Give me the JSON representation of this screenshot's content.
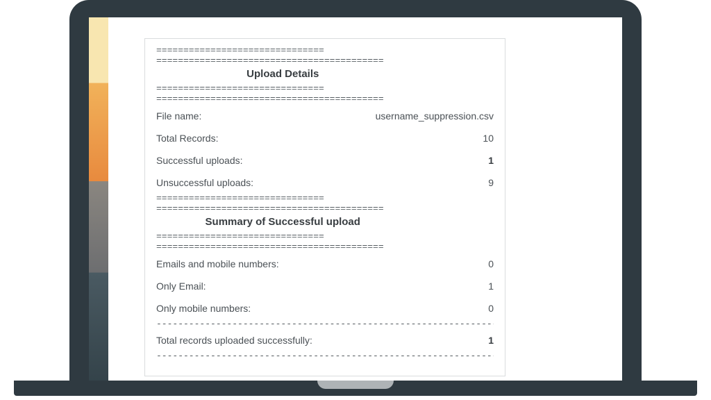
{
  "dividers": {
    "short": "===============================",
    "long": "==========================================",
    "dots": "------------------------------------------------------------------------------------------------------------"
  },
  "sections": {
    "uploadDetails": {
      "title": "Upload Details",
      "rows": {
        "fileName": {
          "label": "File name:",
          "value": "username_suppression.csv",
          "bold": false
        },
        "total": {
          "label": "Total Records:",
          "value": "10",
          "bold": false
        },
        "successful": {
          "label": "Successful uploads:",
          "value": "1",
          "bold": true
        },
        "failed": {
          "label": "Unsuccessful uploads:",
          "value": "9",
          "bold": false
        }
      }
    },
    "summary": {
      "title": "Summary of Successful upload",
      "rows": {
        "both": {
          "label": "Emails and mobile numbers:",
          "value": "0",
          "bold": false
        },
        "onlyEmail": {
          "label": "Only Email:",
          "value": "1",
          "bold": false
        },
        "onlyMobile": {
          "label": "Only mobile numbers:",
          "value": "0",
          "bold": false
        }
      },
      "totalRow": {
        "label": "Total records uploaded successfully:",
        "value": "1",
        "bold": true
      }
    }
  }
}
